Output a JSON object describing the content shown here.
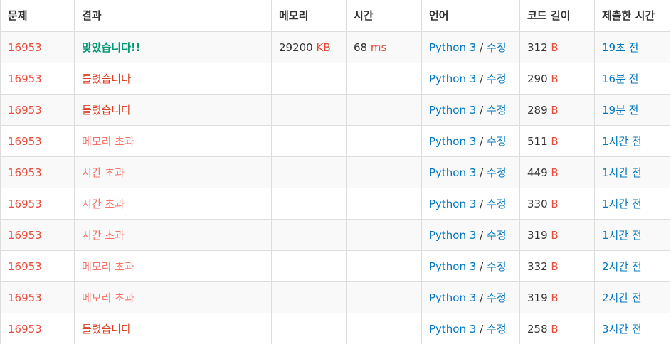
{
  "colors": {
    "problem_link": "#e74c3c",
    "accepted": "#009874",
    "wrong_answer": "#dd4124",
    "limit_exceeded": "#fa7268",
    "link": "#0076c0",
    "unit": "#e74c3c",
    "border": "#dddddd",
    "row_stripe": "#f9f9f9"
  },
  "table": {
    "headers": {
      "problem": "문제",
      "result": "결과",
      "memory": "메모리",
      "time": "시간",
      "language": "언어",
      "code_length": "코드 길이",
      "submitted": "제출한 시간"
    },
    "separator": "/",
    "rows": [
      {
        "problem": "16953",
        "result": "맞았습니다!!",
        "result_type": "ac",
        "memory": "29200",
        "memory_unit": "KB",
        "time": "68",
        "time_unit": "ms",
        "language": "Python 3",
        "edit": "수정",
        "code_length": "312",
        "code_unit": "B",
        "submitted": "19초 전"
      },
      {
        "problem": "16953",
        "result": "틀렸습니다",
        "result_type": "wa",
        "memory": "",
        "memory_unit": "",
        "time": "",
        "time_unit": "",
        "language": "Python 3",
        "edit": "수정",
        "code_length": "290",
        "code_unit": "B",
        "submitted": "16분 전"
      },
      {
        "problem": "16953",
        "result": "틀렸습니다",
        "result_type": "wa",
        "memory": "",
        "memory_unit": "",
        "time": "",
        "time_unit": "",
        "language": "Python 3",
        "edit": "수정",
        "code_length": "289",
        "code_unit": "B",
        "submitted": "19분 전"
      },
      {
        "problem": "16953",
        "result": "메모리 초과",
        "result_type": "mle",
        "memory": "",
        "memory_unit": "",
        "time": "",
        "time_unit": "",
        "language": "Python 3",
        "edit": "수정",
        "code_length": "511",
        "code_unit": "B",
        "submitted": "1시간 전"
      },
      {
        "problem": "16953",
        "result": "시간 초과",
        "result_type": "tle",
        "memory": "",
        "memory_unit": "",
        "time": "",
        "time_unit": "",
        "language": "Python 3",
        "edit": "수정",
        "code_length": "449",
        "code_unit": "B",
        "submitted": "1시간 전"
      },
      {
        "problem": "16953",
        "result": "시간 초과",
        "result_type": "tle",
        "memory": "",
        "memory_unit": "",
        "time": "",
        "time_unit": "",
        "language": "Python 3",
        "edit": "수정",
        "code_length": "330",
        "code_unit": "B",
        "submitted": "1시간 전"
      },
      {
        "problem": "16953",
        "result": "시간 초과",
        "result_type": "tle",
        "memory": "",
        "memory_unit": "",
        "time": "",
        "time_unit": "",
        "language": "Python 3",
        "edit": "수정",
        "code_length": "319",
        "code_unit": "B",
        "submitted": "1시간 전"
      },
      {
        "problem": "16953",
        "result": "메모리 초과",
        "result_type": "mle",
        "memory": "",
        "memory_unit": "",
        "time": "",
        "time_unit": "",
        "language": "Python 3",
        "edit": "수정",
        "code_length": "332",
        "code_unit": "B",
        "submitted": "2시간 전"
      },
      {
        "problem": "16953",
        "result": "메모리 초과",
        "result_type": "mle",
        "memory": "",
        "memory_unit": "",
        "time": "",
        "time_unit": "",
        "language": "Python 3",
        "edit": "수정",
        "code_length": "319",
        "code_unit": "B",
        "submitted": "2시간 전"
      },
      {
        "problem": "16953",
        "result": "틀렸습니다",
        "result_type": "wa",
        "memory": "",
        "memory_unit": "",
        "time": "",
        "time_unit": "",
        "language": "Python 3",
        "edit": "수정",
        "code_length": "258",
        "code_unit": "B",
        "submitted": "3시간 전"
      }
    ]
  }
}
